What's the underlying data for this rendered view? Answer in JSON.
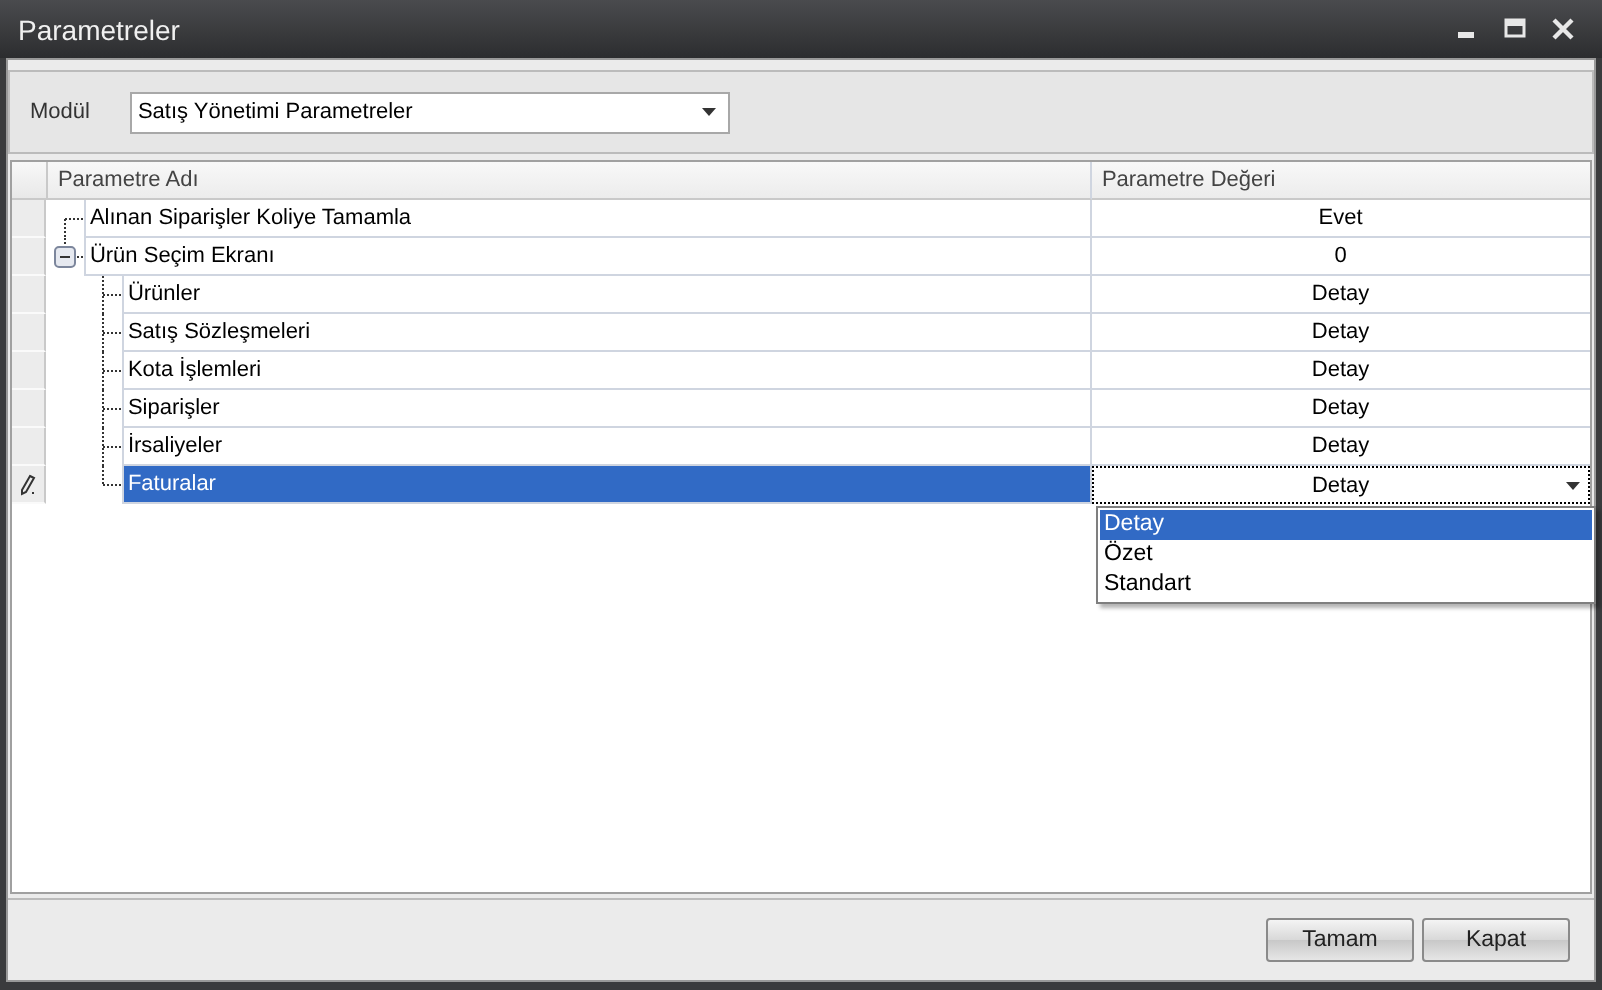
{
  "window": {
    "title": "Parametreler"
  },
  "module": {
    "label": "Modül",
    "value": "Satış Yönetimi Parametreler"
  },
  "table": {
    "columns": [
      "Parametre Adı",
      "Parametre Değeri"
    ],
    "rows": [
      {
        "name": "Alınan Siparişler Koliye Tamamla",
        "value": "Evet",
        "selected": false,
        "editing": false
      },
      {
        "name": "Ürün Seçim Ekranı",
        "value": "0",
        "selected": false,
        "editing": false,
        "expanded": true,
        "children": [
          {
            "name": "Ürünler",
            "value": "Detay",
            "selected": false,
            "editing": false
          },
          {
            "name": "Satış Sözleşmeleri",
            "value": "Detay",
            "selected": false,
            "editing": false
          },
          {
            "name": "Kota İşlemleri",
            "value": "Detay",
            "selected": false,
            "editing": false
          },
          {
            "name": "Siparişler",
            "value": "Detay",
            "selected": false,
            "editing": false
          },
          {
            "name": "İrsaliyeler",
            "value": "Detay",
            "selected": false,
            "editing": false
          },
          {
            "name": "Faturalar",
            "value": "Detay",
            "selected": true,
            "editing": true
          }
        ]
      }
    ]
  },
  "dropdown": {
    "options": [
      {
        "label": "Detay",
        "selected": true
      },
      {
        "label": "Özet",
        "selected": false
      },
      {
        "label": "Standart",
        "selected": false
      }
    ]
  },
  "buttons": [
    "Tamam",
    "Kapat"
  ]
}
